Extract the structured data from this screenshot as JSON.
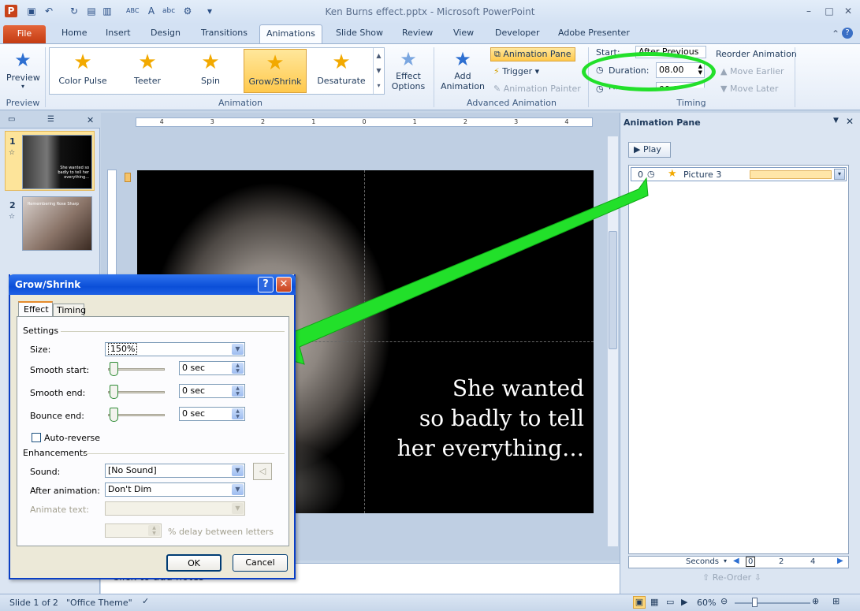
{
  "window": {
    "title": "Ken Burns effect.pptx - Microsoft PowerPoint"
  },
  "tabs": [
    "File",
    "Home",
    "Insert",
    "Design",
    "Transitions",
    "Animations",
    "Slide Show",
    "Review",
    "View",
    "Developer",
    "Adobe Presenter"
  ],
  "ribbon": {
    "preview": {
      "label": "Preview",
      "group": "Preview"
    },
    "animation_group": "Animation",
    "animations": [
      "Color Pulse",
      "Teeter",
      "Spin",
      "Grow/Shrink",
      "Desaturate"
    ],
    "effect_options": "Effect Options",
    "add_animation": "Add Animation",
    "animation_pane": "Animation Pane",
    "trigger": "Trigger",
    "animation_painter": "Animation Painter",
    "advanced_group": "Advanced Animation",
    "start_label": "Start:",
    "start_value": "After Previous",
    "duration_label": "Duration:",
    "duration_value": "08.00",
    "delay_label": "Delay:",
    "delay_value": "00.00",
    "reorder": "Reorder Animation",
    "move_earlier": "Move Earlier",
    "move_later": "Move Later",
    "timing_group": "Timing"
  },
  "ruler": [
    "4",
    "3",
    "2",
    "1",
    "0",
    "1",
    "2",
    "3",
    "4"
  ],
  "slides": [
    {
      "number": "1",
      "thumb_text": "She wanted so badly to tell her everything..."
    },
    {
      "number": "2",
      "thumb_text": "Remembering Rose Sharp"
    }
  ],
  "slide": {
    "lines": [
      "She wanted",
      "so badly to tell",
      "her everything…"
    ]
  },
  "notes": {
    "placeholder": "Click to add notes"
  },
  "animation_pane": {
    "title": "Animation Pane",
    "play": "Play",
    "item": {
      "index": "0",
      "name": "Picture 3"
    },
    "seconds": "Seconds",
    "timeline": [
      "0",
      "2",
      "4"
    ],
    "reorder": "Re-Order"
  },
  "dialog": {
    "title": "Grow/Shrink",
    "tabs": [
      "Effect",
      "Timing"
    ],
    "settings": "Settings",
    "size_label": "Size:",
    "size_value": "150%",
    "smooth_start_label": "Smooth start:",
    "smooth_start_value": "0 sec",
    "smooth_end_label": "Smooth end:",
    "smooth_end_value": "0 sec",
    "bounce_end_label": "Bounce end:",
    "bounce_end_value": "0 sec",
    "auto_reverse": "Auto-reverse",
    "enhancements": "Enhancements",
    "sound_label": "Sound:",
    "sound_value": "[No Sound]",
    "after_label": "After animation:",
    "after_value": "Don't Dim",
    "animate_text_label": "Animate text:",
    "delay_letters": "% delay between letters",
    "ok": "OK",
    "cancel": "Cancel"
  },
  "status": {
    "slide": "Slide 1 of 2",
    "theme": "\"Office Theme\"",
    "zoom": "60%"
  },
  "colors": {
    "highlight_green": "#22e02a",
    "accent_blue": "#0b4fd8"
  }
}
